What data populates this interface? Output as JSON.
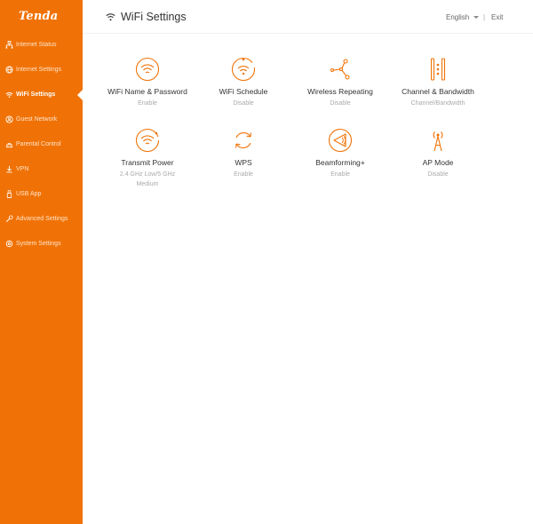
{
  "brand": {
    "logo_text": "Tenda",
    "accent_color": "#f07206"
  },
  "sidebar": {
    "items": [
      {
        "label": "Internet Status",
        "icon": "network-status-icon"
      },
      {
        "label": "Internet Settings",
        "icon": "globe-icon"
      },
      {
        "label": "WiFi Settings",
        "icon": "wifi-icon",
        "active": true
      },
      {
        "label": "Guest Network",
        "icon": "guest-icon"
      },
      {
        "label": "Parental Control",
        "icon": "parental-icon"
      },
      {
        "label": "VPN",
        "icon": "download-arrow-icon"
      },
      {
        "label": "USB App",
        "icon": "usb-icon"
      },
      {
        "label": "Advanced Settings",
        "icon": "wrench-icon"
      },
      {
        "label": "System Settings",
        "icon": "gear-icon"
      }
    ]
  },
  "header": {
    "title": "WiFi Settings",
    "language": "English",
    "separator": "|",
    "exit_label": "Exit"
  },
  "tiles": [
    {
      "name": "WiFi Name & Password",
      "status": "Enable",
      "icon": "wifi-circle-icon"
    },
    {
      "name": "WiFi Schedule",
      "status": "Disable",
      "icon": "wifi-clock-icon"
    },
    {
      "name": "Wireless Repeating",
      "status": "Disable",
      "icon": "repeater-icon"
    },
    {
      "name": "Channel & Bandwidth",
      "status": "Channel/Bandwidth",
      "icon": "channel-bars-icon"
    },
    {
      "name": "Transmit Power",
      "status": "2.4 GHz Low/5 GHz Medium",
      "icon": "transmit-power-icon"
    },
    {
      "name": "WPS",
      "status": "Enable",
      "icon": "wps-refresh-icon"
    },
    {
      "name": "Beamforming+",
      "status": "Enable",
      "icon": "beamforming-icon"
    },
    {
      "name": "AP Mode",
      "status": "Disable",
      "icon": "antenna-icon"
    }
  ]
}
